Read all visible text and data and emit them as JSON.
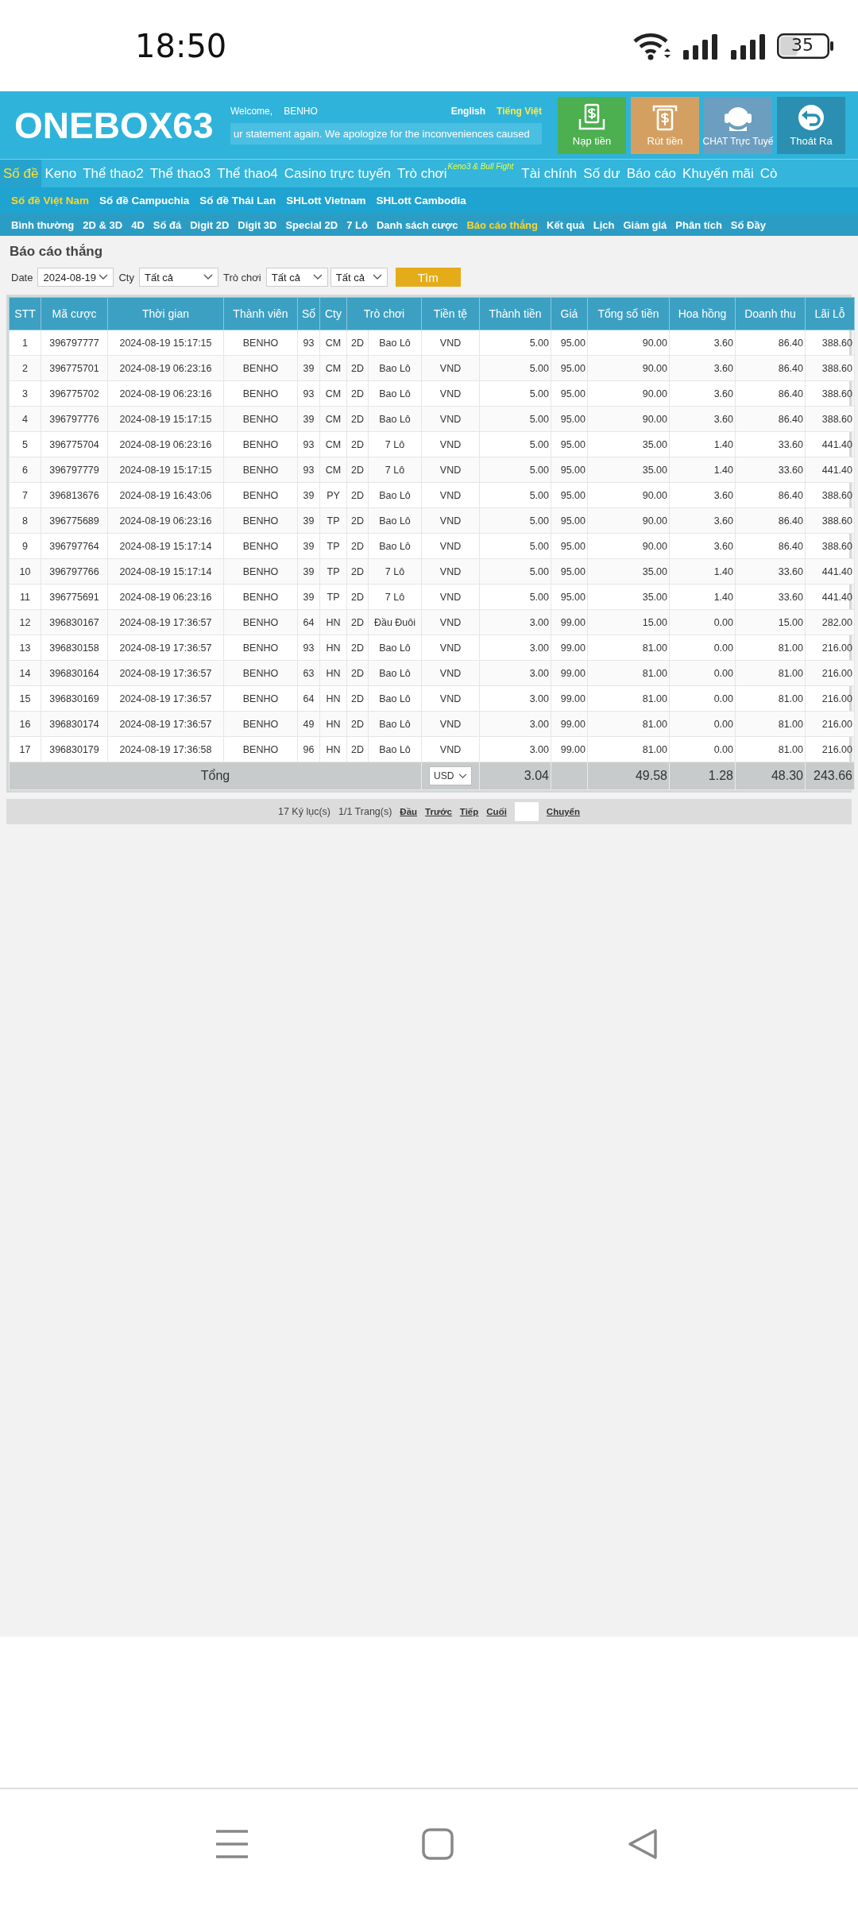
{
  "status_bar": {
    "time": "18:50",
    "battery": "35"
  },
  "header": {
    "logo": "ONEBOX63",
    "welcome_label": "Welcome,",
    "username": "BENHO",
    "languages": [
      {
        "label": "English",
        "selected": false
      },
      {
        "label": "Tiếng Việt",
        "selected": true
      }
    ],
    "marquee": "ur statement again. We apologize for the inconveniences caused",
    "buttons": [
      {
        "label": "Nạp tiền",
        "kind": "deposit"
      },
      {
        "label": "Rút tiền",
        "kind": "withdraw"
      },
      {
        "label": "CHAT Trực Tuyế",
        "kind": "chat"
      },
      {
        "label": "Thoát Ra",
        "kind": "logout"
      }
    ]
  },
  "main_nav": [
    {
      "label": "Số đề",
      "selected": true
    },
    {
      "label": "Keno",
      "selected": false
    },
    {
      "label": "Thể thao2",
      "selected": false
    },
    {
      "label": "Thể thao3",
      "selected": false
    },
    {
      "label": "Thể thao4",
      "selected": false
    },
    {
      "label": "Casino trực tuyến",
      "selected": false
    },
    {
      "label": "Trò chơi",
      "selected": false,
      "badge": "Keno3 & Bull Fight"
    },
    {
      "label": "Tài chính",
      "selected": false
    },
    {
      "label": "Số dư",
      "selected": false
    },
    {
      "label": "Báo cáo",
      "selected": false
    },
    {
      "label": "Khuyến mãi",
      "selected": false
    },
    {
      "label": "Cò",
      "selected": false
    }
  ],
  "sub_nav": [
    {
      "label": "Số đề Việt Nam",
      "selected": true
    },
    {
      "label": "Số đề Campuchia",
      "selected": false
    },
    {
      "label": "Số đề Thái Lan",
      "selected": false
    },
    {
      "label": "SHLott Vietnam",
      "selected": false
    },
    {
      "label": "SHLott Cambodia",
      "selected": false
    }
  ],
  "game_nav": [
    {
      "label": "Bình thường",
      "selected": false
    },
    {
      "label": "2D & 3D",
      "selected": false
    },
    {
      "label": "4D",
      "selected": false
    },
    {
      "label": "Số đá",
      "selected": false
    },
    {
      "label": "Digit 2D",
      "selected": false
    },
    {
      "label": "Digit 3D",
      "selected": false
    },
    {
      "label": "Special 2D",
      "selected": false
    },
    {
      "label": "7 Lô",
      "selected": false
    },
    {
      "label": "Danh sách cược",
      "selected": false
    },
    {
      "label": "Báo cáo thắng",
      "selected": true
    },
    {
      "label": "Kết quả",
      "selected": false
    },
    {
      "label": "Lịch",
      "selected": false
    },
    {
      "label": "Giảm giá",
      "selected": false
    },
    {
      "label": "Phân tích",
      "selected": false
    },
    {
      "label": "Số Đầy",
      "selected": false
    }
  ],
  "page_title": "Báo cáo thắng",
  "filters": [
    {
      "label": "Date",
      "value": "2024-08-19"
    },
    {
      "label": "Cty",
      "value": "Tất cả"
    },
    {
      "label": "Trò chơi",
      "value": "Tất cả"
    },
    {
      "value": "Tất cả"
    }
  ],
  "search_button": "Tìm",
  "table": {
    "columns": [
      "STT",
      "Mã cược",
      "Thời gian",
      "Thành viên",
      "Số",
      "Cty",
      "Trò chơi",
      "Tiền tệ",
      "Thành tiền",
      "Giá",
      "Tổng số tiền",
      "Hoa hồng",
      "Doanh thu",
      "Lãi Lỗ"
    ],
    "rows": [
      [
        "1",
        "396797777",
        "2024-08-19 15:17:15",
        "BENHO",
        "93",
        "CM",
        {
          "type": "2D",
          "game": "Bao Lô"
        },
        "VND",
        "5.00",
        "95.00",
        "90.00",
        "3.60",
        "86.40",
        "388.60"
      ],
      [
        "2",
        "396775701",
        "2024-08-19 06:23:16",
        "BENHO",
        "39",
        "CM",
        {
          "type": "2D",
          "game": "Bao Lô"
        },
        "VND",
        "5.00",
        "95.00",
        "90.00",
        "3.60",
        "86.40",
        "388.60"
      ],
      [
        "3",
        "396775702",
        "2024-08-19 06:23:16",
        "BENHO",
        "93",
        "CM",
        {
          "type": "2D",
          "game": "Bao Lô"
        },
        "VND",
        "5.00",
        "95.00",
        "90.00",
        "3.60",
        "86.40",
        "388.60"
      ],
      [
        "4",
        "396797776",
        "2024-08-19 15:17:15",
        "BENHO",
        "39",
        "CM",
        {
          "type": "2D",
          "game": "Bao Lô"
        },
        "VND",
        "5.00",
        "95.00",
        "90.00",
        "3.60",
        "86.40",
        "388.60"
      ],
      [
        "5",
        "396775704",
        "2024-08-19 06:23:16",
        "BENHO",
        "93",
        "CM",
        {
          "type": "2D",
          "game": "7 Lô"
        },
        "VND",
        "5.00",
        "95.00",
        "35.00",
        "1.40",
        "33.60",
        "441.40"
      ],
      [
        "6",
        "396797779",
        "2024-08-19 15:17:15",
        "BENHO",
        "93",
        "CM",
        {
          "type": "2D",
          "game": "7 Lô"
        },
        "VND",
        "5.00",
        "95.00",
        "35.00",
        "1.40",
        "33.60",
        "441.40"
      ],
      [
        "7",
        "396813676",
        "2024-08-19 16:43:06",
        "BENHO",
        "39",
        "PY",
        {
          "type": "2D",
          "game": "Bao Lô"
        },
        "VND",
        "5.00",
        "95.00",
        "90.00",
        "3.60",
        "86.40",
        "388.60"
      ],
      [
        "8",
        "396775689",
        "2024-08-19 06:23:16",
        "BENHO",
        "39",
        "TP",
        {
          "type": "2D",
          "game": "Bao Lô"
        },
        "VND",
        "5.00",
        "95.00",
        "90.00",
        "3.60",
        "86.40",
        "388.60"
      ],
      [
        "9",
        "396797764",
        "2024-08-19 15:17:14",
        "BENHO",
        "39",
        "TP",
        {
          "type": "2D",
          "game": "Bao Lô"
        },
        "VND",
        "5.00",
        "95.00",
        "90.00",
        "3.60",
        "86.40",
        "388.60"
      ],
      [
        "10",
        "396797766",
        "2024-08-19 15:17:14",
        "BENHO",
        "39",
        "TP",
        {
          "type": "2D",
          "game": "7 Lô"
        },
        "VND",
        "5.00",
        "95.00",
        "35.00",
        "1.40",
        "33.60",
        "441.40"
      ],
      [
        "11",
        "396775691",
        "2024-08-19 06:23:16",
        "BENHO",
        "39",
        "TP",
        {
          "type": "2D",
          "game": "7 Lô"
        },
        "VND",
        "5.00",
        "95.00",
        "35.00",
        "1.40",
        "33.60",
        "441.40"
      ],
      [
        "12",
        "396830167",
        "2024-08-19 17:36:57",
        "BENHO",
        "64",
        "HN",
        {
          "type": "2D",
          "game": "Đầu Đuôi"
        },
        "VND",
        "3.00",
        "99.00",
        "15.00",
        "0.00",
        "15.00",
        "282.00"
      ],
      [
        "13",
        "396830158",
        "2024-08-19 17:36:57",
        "BENHO",
        "93",
        "HN",
        {
          "type": "2D",
          "game": "Bao Lô"
        },
        "VND",
        "3.00",
        "99.00",
        "81.00",
        "0.00",
        "81.00",
        "216.00"
      ],
      [
        "14",
        "396830164",
        "2024-08-19 17:36:57",
        "BENHO",
        "63",
        "HN",
        {
          "type": "2D",
          "game": "Bao Lô"
        },
        "VND",
        "3.00",
        "99.00",
        "81.00",
        "0.00",
        "81.00",
        "216.00"
      ],
      [
        "15",
        "396830169",
        "2024-08-19 17:36:57",
        "BENHO",
        "64",
        "HN",
        {
          "type": "2D",
          "game": "Bao Lô"
        },
        "VND",
        "3.00",
        "99.00",
        "81.00",
        "0.00",
        "81.00",
        "216.00"
      ],
      [
        "16",
        "396830174",
        "2024-08-19 17:36:57",
        "BENHO",
        "49",
        "HN",
        {
          "type": "2D",
          "game": "Bao Lô"
        },
        "VND",
        "3.00",
        "99.00",
        "81.00",
        "0.00",
        "81.00",
        "216.00"
      ],
      [
        "17",
        "396830179",
        "2024-08-19 17:36:58",
        "BENHO",
        "96",
        "HN",
        {
          "type": "2D",
          "game": "Bao Lô"
        },
        "VND",
        "3.00",
        "99.00",
        "81.00",
        "0.00",
        "81.00",
        "216.00"
      ]
    ],
    "total": {
      "label": "Tổng",
      "currency": "USD",
      "amount": "3.04",
      "total_sum": "49.58",
      "commission": "1.28",
      "turnover": "48.30",
      "profit_loss": "243.66"
    }
  },
  "pagination": {
    "records": "17 Ký lục(s)",
    "pages": "1/1 Trang(s)",
    "links": [
      "Đầu",
      "Trước",
      "Tiếp",
      "Cuối"
    ],
    "go": "Chuyển"
  }
}
